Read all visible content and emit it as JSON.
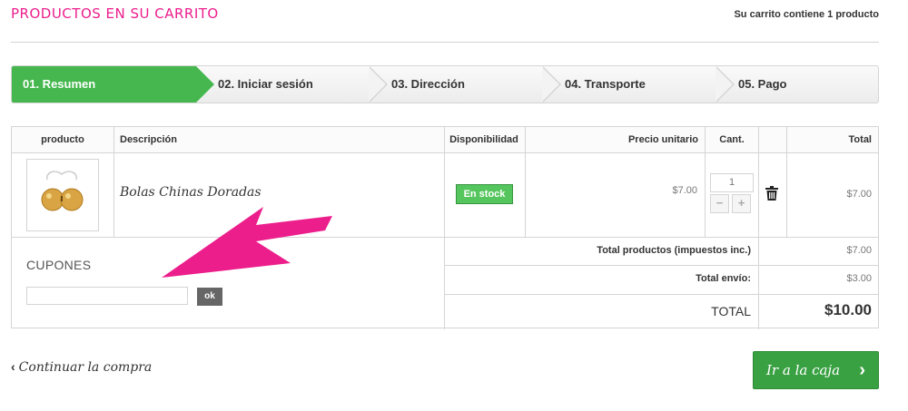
{
  "header": {
    "title": "PRODUCTOS EN SU CARRITO",
    "cart_summary": "Su carrito contiene 1 producto"
  },
  "steps": [
    {
      "label": "01. Resumen",
      "active": true
    },
    {
      "label": "02. Iniciar sesión",
      "active": false
    },
    {
      "label": "03. Dirección",
      "active": false
    },
    {
      "label": "04. Transporte",
      "active": false
    },
    {
      "label": "05. Pago",
      "active": false
    }
  ],
  "table": {
    "columns": [
      "producto",
      "Descripción",
      "Disponibilidad",
      "Precio unitario",
      "Cant.",
      "Total"
    ],
    "items": [
      {
        "name": "Bolas Chinas Doradas",
        "availability": "En stock",
        "unit_price": "$7.00",
        "quantity": "1",
        "total": "$7.00"
      }
    ]
  },
  "coupon": {
    "title": "CUPONES",
    "input_value": "",
    "submit_label": "ok"
  },
  "summary": {
    "products_label": "Total productos (impuestos inc.)",
    "products_value": "$7.00",
    "shipping_label": "Total envío:",
    "shipping_value": "$3.00",
    "grand_label": "TOTAL",
    "grand_value": "$10.00"
  },
  "actions": {
    "continue_label": "Continuar la compra",
    "checkout_label": "Ir a la caja"
  },
  "colors": {
    "accent_pink": "#ec1e8c",
    "active_step_green": "#45b74e",
    "stock_green": "#55c65e",
    "checkout_green": "#3aa143"
  },
  "icons": [
    "trash-icon",
    "chevron-left-icon",
    "chevron-right-icon",
    "pink-arrow-annotation"
  ]
}
